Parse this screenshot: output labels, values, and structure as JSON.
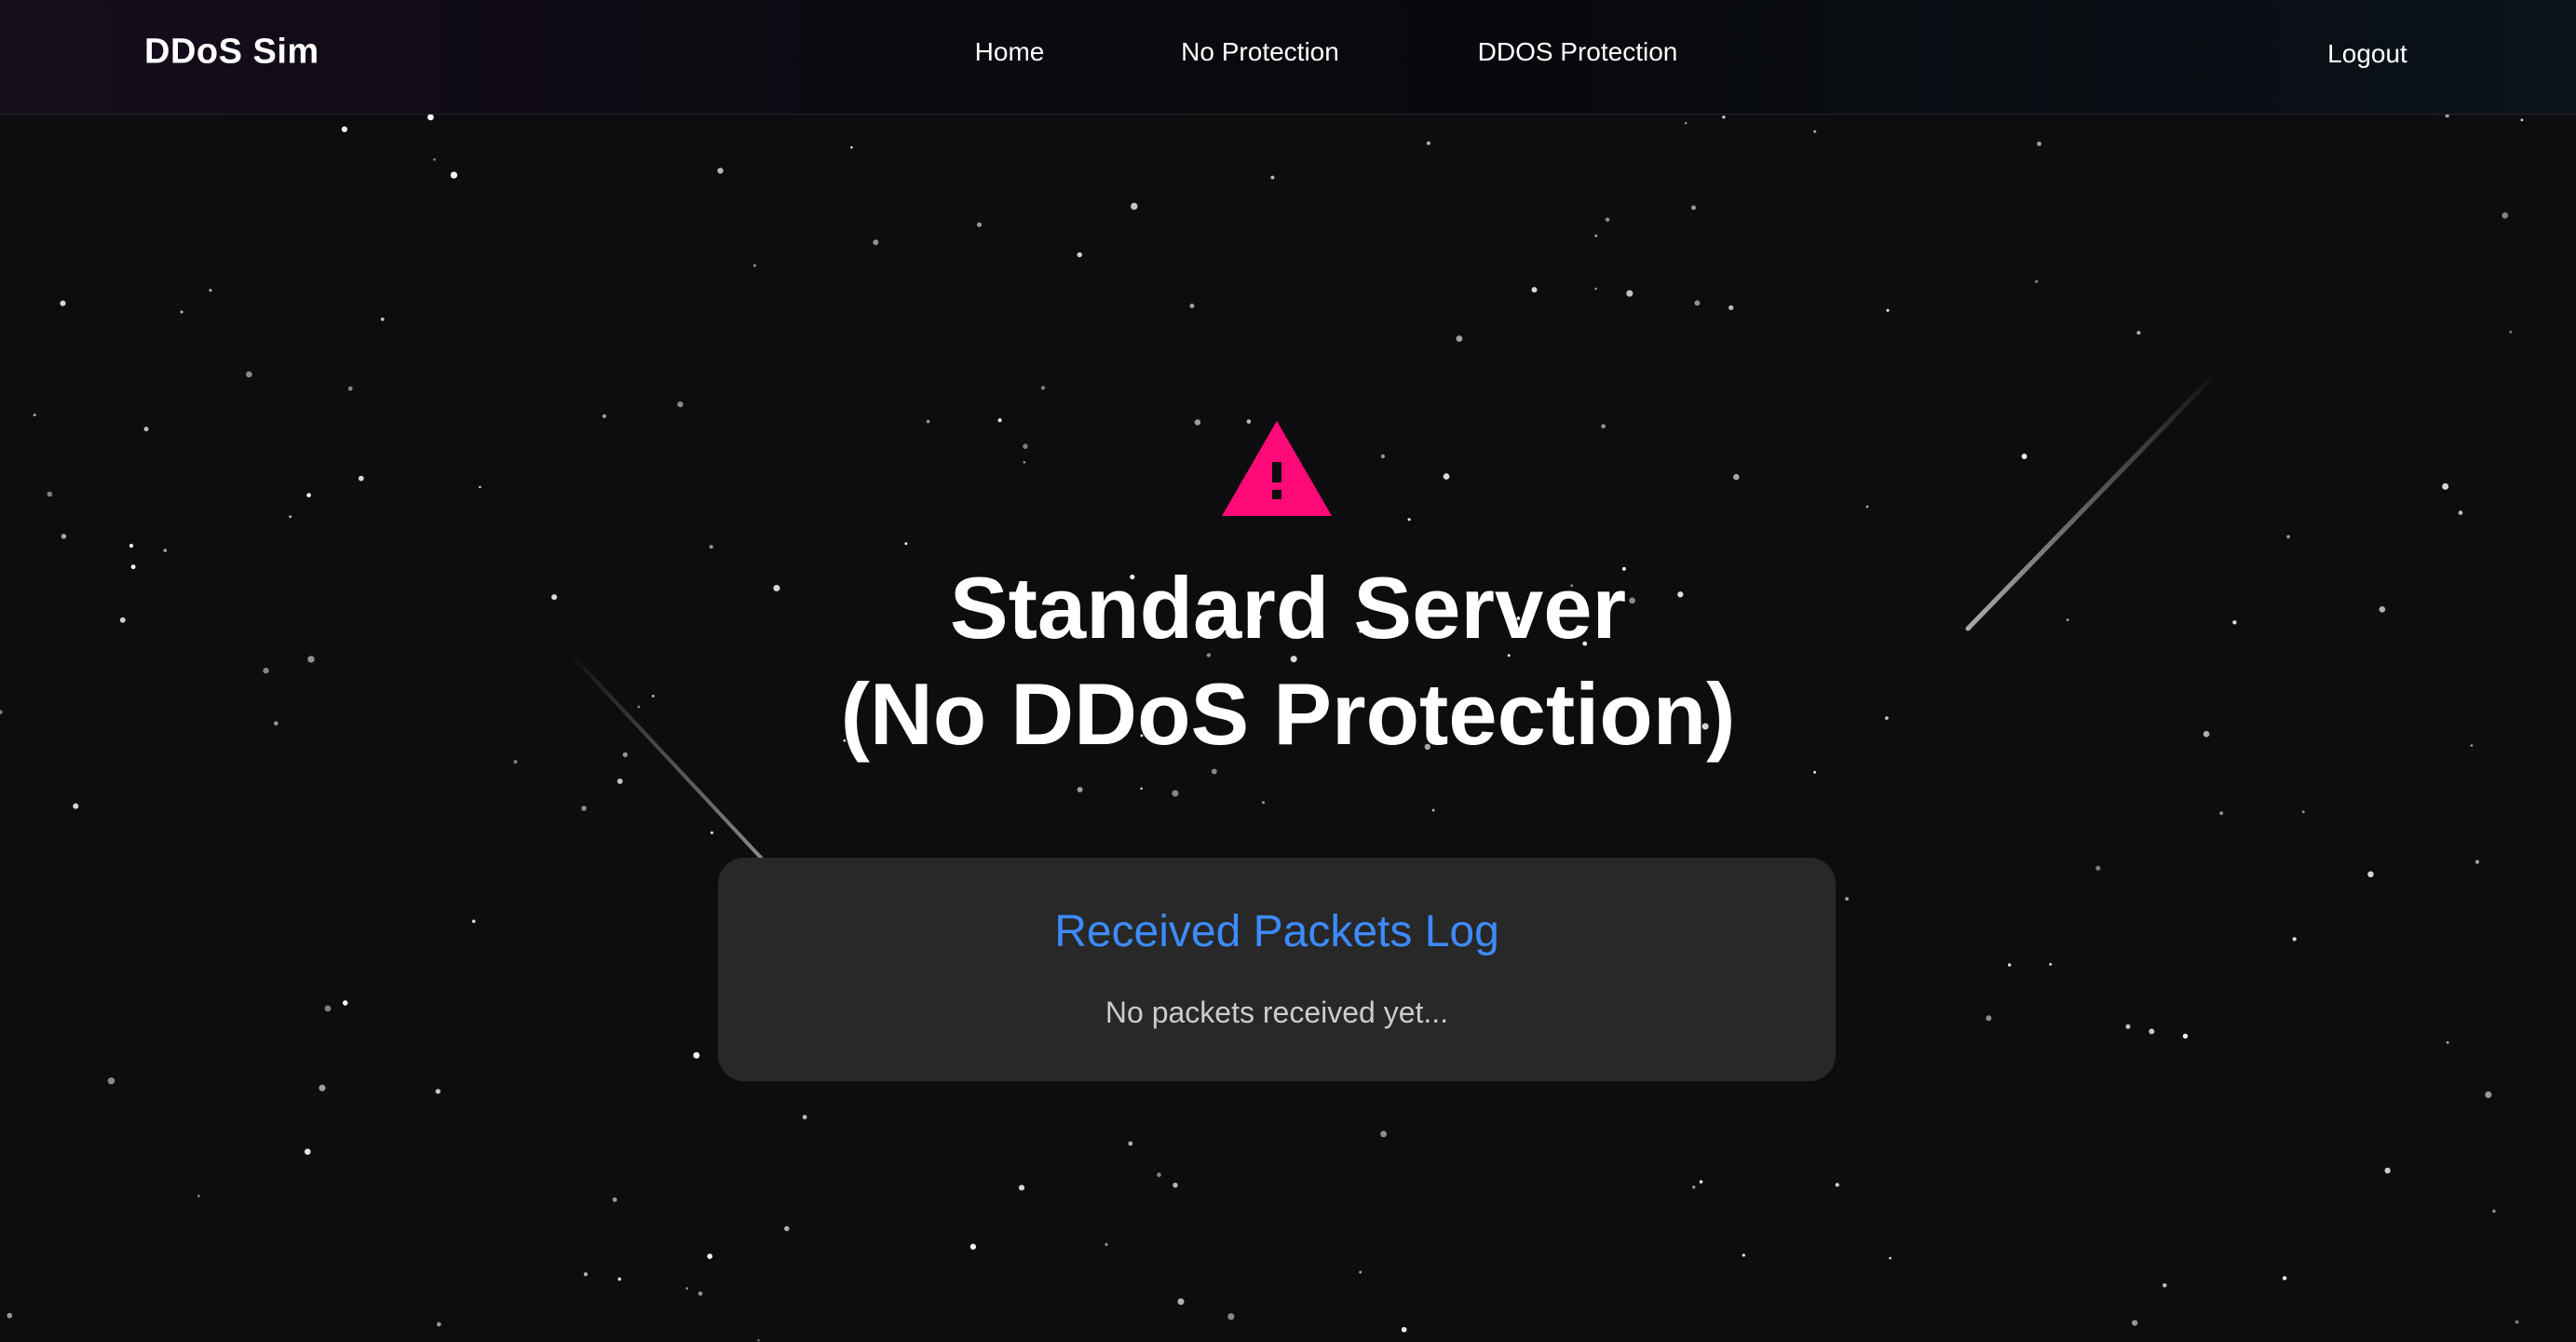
{
  "navbar": {
    "brand": "DDoS Sim",
    "links": [
      {
        "label": "Home"
      },
      {
        "label": "No Protection"
      },
      {
        "label": "DDOS Protection"
      }
    ],
    "logout_label": "Logout"
  },
  "main": {
    "icon": "warning-triangle-icon",
    "title_line1": "Standard Server",
    "title_line2": "(No DDoS Protection)",
    "log": {
      "heading": "Received Packets Log",
      "empty_message": "No packets received yet..."
    }
  },
  "colors": {
    "background": "#0d0d0f",
    "accent_warning": "#ff0a78",
    "log_heading": "#3d8bfd",
    "card": "#282828"
  }
}
